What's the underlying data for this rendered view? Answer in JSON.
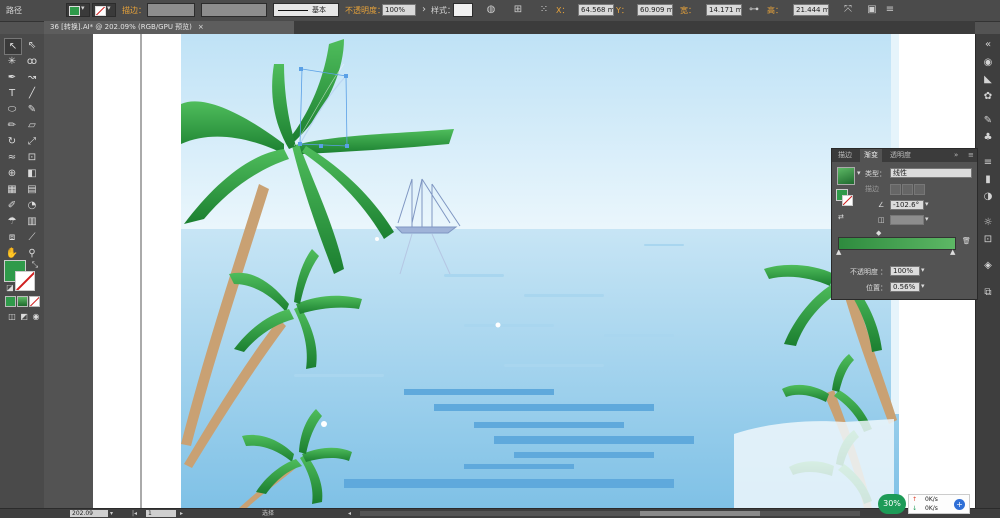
{
  "control_bar": {
    "path_label": "路径",
    "stroke_label": "描边：",
    "brush_label": "基本",
    "opacity_label": "不透明度：",
    "opacity_value": "100%",
    "style_label": "样式：",
    "x_label": "X：",
    "x_value": "64.568 mm",
    "y_label": "Y：",
    "y_value": "60.909 mm",
    "w_label": "宽：",
    "w_value": "14.171 mm",
    "h_label": "高：",
    "h_value": "21.444 mm",
    "fill_color": "#2f9a4a"
  },
  "document": {
    "tab_title": "36 [转换].AI* @ 202.09% (RGB/GPU 预览)",
    "close_icon": "×"
  },
  "gradient_panel": {
    "tabs": [
      "描边",
      "渐变",
      "透明度"
    ],
    "active_tab": "渐变",
    "type_label": "类型：",
    "type_value": "线性",
    "stroke_label": "描边",
    "angle_value": "-102.6°",
    "opacity_label": "不透明度",
    "opacity_value": "100%",
    "position_label": "位置",
    "position_value": "0.56%",
    "gradient_start": "#2e8b3e",
    "gradient_end": "#5db865"
  },
  "status_bar": {
    "zoom_value": "202.09",
    "page_value": "1",
    "mode_label": "选择"
  },
  "network_widget": {
    "percent": "30%",
    "up_speed": "0K/s",
    "down_speed": "0K/s"
  }
}
